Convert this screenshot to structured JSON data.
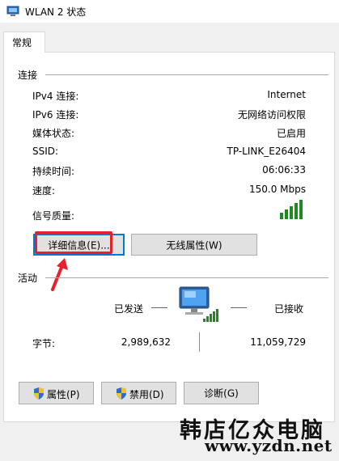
{
  "window": {
    "title": "WLAN 2 状态"
  },
  "tabs": [
    {
      "label": "常规"
    }
  ],
  "connection": {
    "section_label": "连接",
    "rows": [
      {
        "label": "IPv4 连接:",
        "value": "Internet"
      },
      {
        "label": "IPv6 连接:",
        "value": "无网络访问权限"
      },
      {
        "label": "媒体状态:",
        "value": "已启用"
      },
      {
        "label": "SSID:",
        "value": "TP-LINK_E26404"
      },
      {
        "label": "持续时间:",
        "value": "06:06:33"
      },
      {
        "label": "速度:",
        "value": "150.0 Mbps"
      },
      {
        "label": "信号质量:",
        "value": ""
      }
    ],
    "signal_bars": 5,
    "details_button": "详细信息(E)...",
    "wireless_props_button": "无线属性(W)"
  },
  "activity": {
    "section_label": "活动",
    "sent_label": "已发送",
    "received_label": "已接收",
    "bytes_label": "字节:",
    "bytes_sent": "2,989,632",
    "bytes_received": "11,059,729"
  },
  "bottom_buttons": {
    "properties": "属性(P)",
    "disable": "禁用(D)",
    "diagnose": "诊断(G)"
  },
  "watermark": {
    "line1": "韩店亿众电脑",
    "line2": "www.yzdn.net"
  },
  "colors": {
    "annotation": "#e8202a",
    "focus": "#0078d7",
    "signal": "#1f8b1f"
  }
}
